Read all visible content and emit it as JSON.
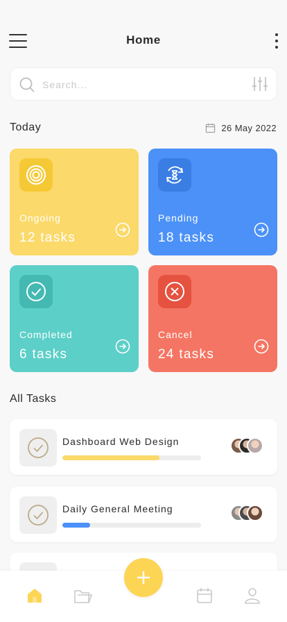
{
  "header": {
    "title": "Home"
  },
  "search": {
    "placeholder": "Search..."
  },
  "today": {
    "heading": "Today",
    "date": "26 May 2022"
  },
  "status_cards": [
    {
      "label": "Ongoing",
      "count": "12 tasks",
      "color": "#fbd96a",
      "icon": "ongoing-target-icon"
    },
    {
      "label": "Pending",
      "count": "18 tasks",
      "color": "#4b91f7",
      "icon": "hourglass-icon"
    },
    {
      "label": "Completed",
      "count": "6 tasks",
      "color": "#5ccfc8",
      "icon": "check-circle-icon"
    },
    {
      "label": "Cancel",
      "count": "24 tasks",
      "color": "#f47563",
      "icon": "x-circle-icon"
    }
  ],
  "all_tasks": {
    "heading": "All Tasks",
    "items": [
      {
        "name": "Dashboard Web Design",
        "progress": 0.7,
        "bar_color": "#fbd96a"
      },
      {
        "name": "Daily General Meeting",
        "progress": 0.2,
        "bar_color": "#4b91f7"
      }
    ]
  },
  "bottom_nav": {
    "active": "home",
    "accent": "#fcd555"
  }
}
